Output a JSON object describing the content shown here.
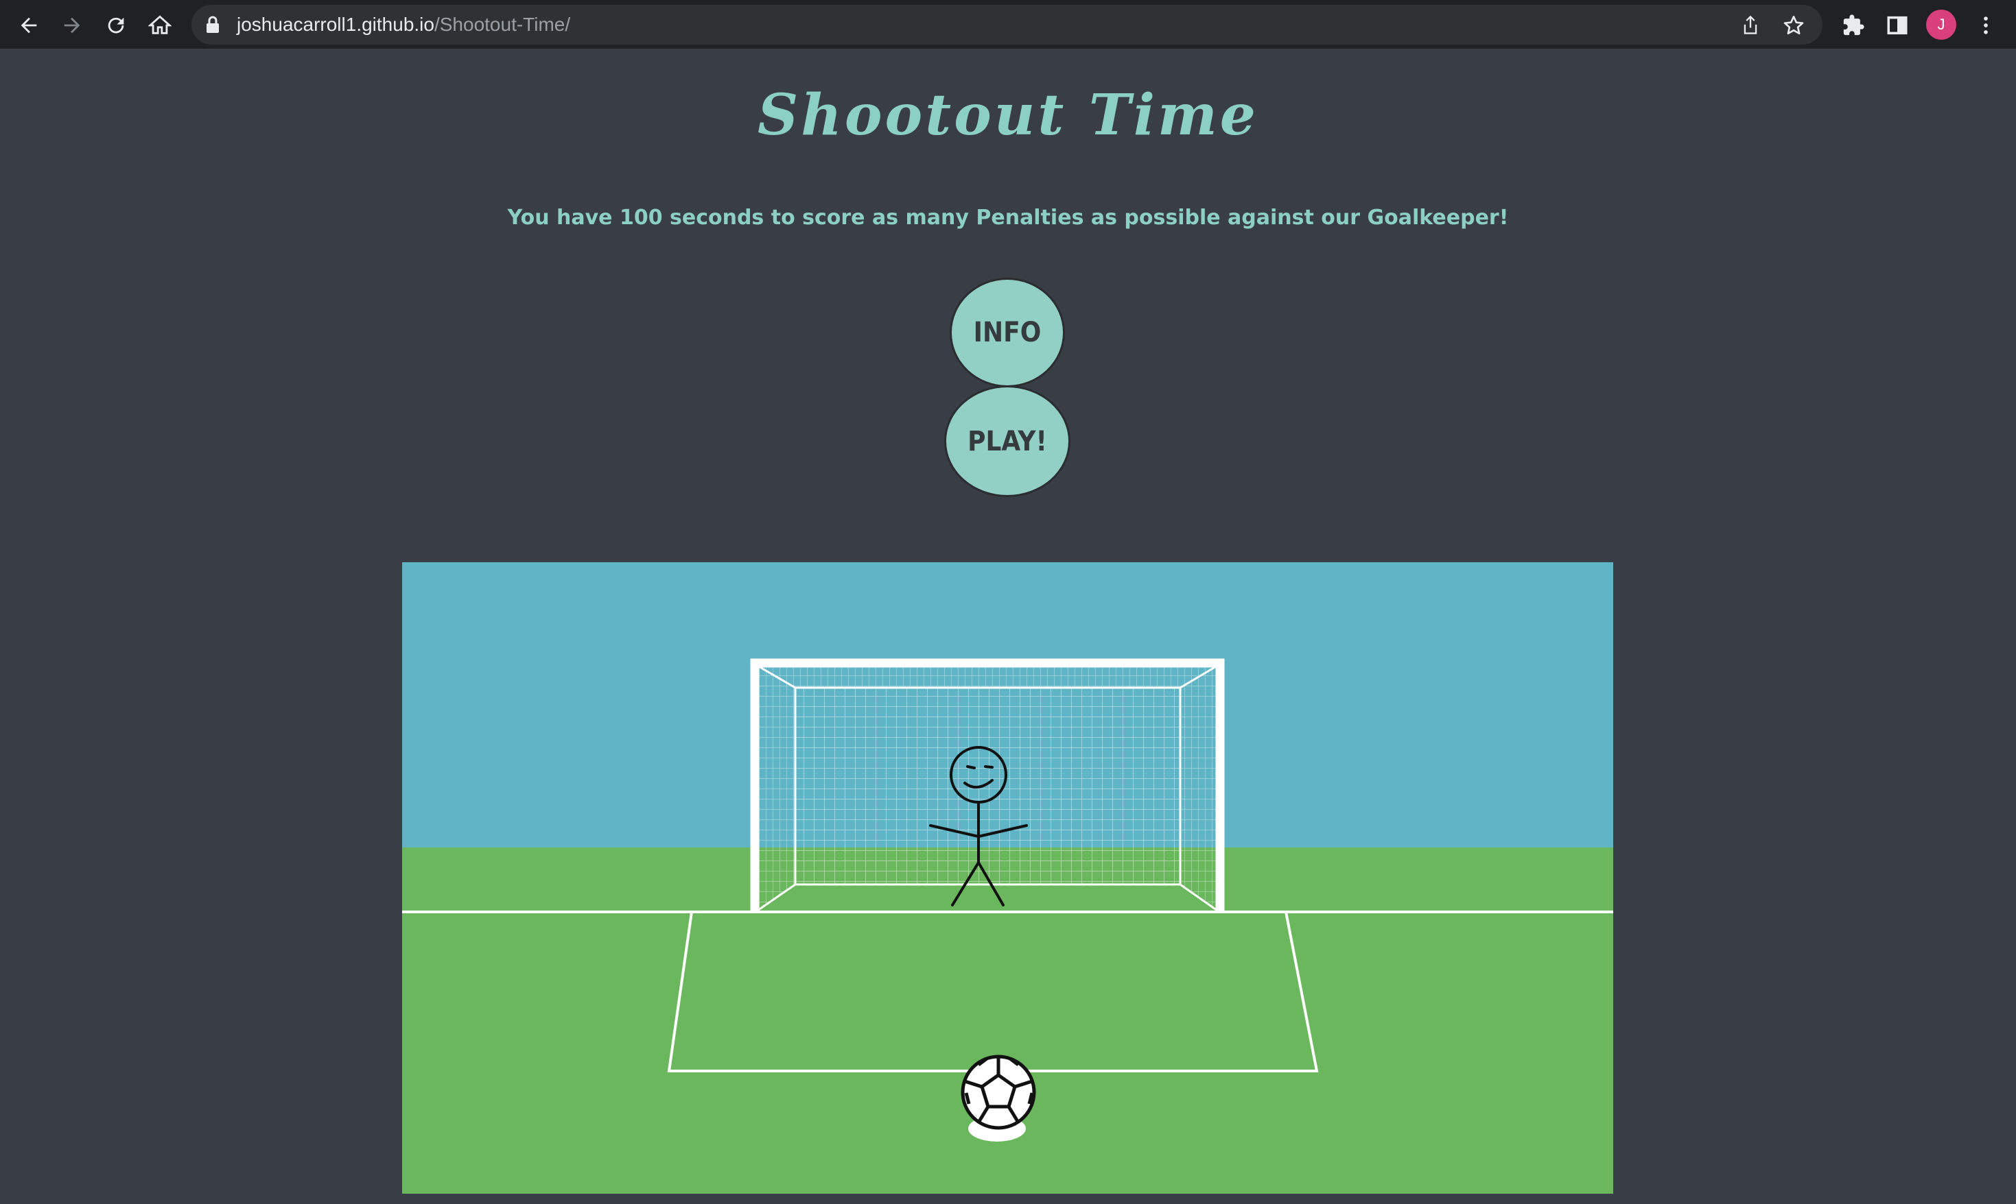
{
  "browser": {
    "url_host": "joshuacarroll1.github.io",
    "url_path": "/Shootout-Time/",
    "profile_initial": "J",
    "profile_color": "#d93f7a"
  },
  "page": {
    "title": "Shootout Time",
    "subtitle": "You have 100 seconds to score as many Penalties as possible against our Goalkeeper!",
    "info_label": "INFO",
    "play_label": "PLAY!"
  },
  "colors": {
    "background": "#393d45",
    "accent": "#8ccfc4",
    "button": "#92d0c5",
    "sky": "#5fb4c6",
    "grass": "#6bb75d"
  },
  "icons": [
    "back-arrow-icon",
    "forward-arrow-icon",
    "reload-icon",
    "home-icon",
    "lock-icon",
    "share-icon",
    "star-icon",
    "extensions-icon",
    "side-panel-icon",
    "menu-dots-icon"
  ]
}
